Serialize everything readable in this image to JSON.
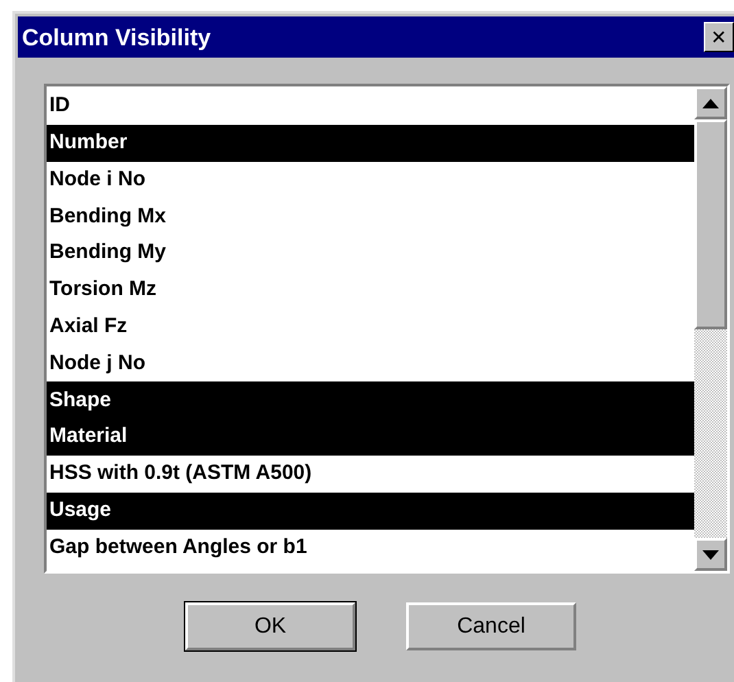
{
  "window": {
    "title": "Column Visibility",
    "close": "✕"
  },
  "columns": [
    {
      "label": "ID",
      "selected": false
    },
    {
      "label": "Number",
      "selected": true
    },
    {
      "label": "Node i No",
      "selected": false
    },
    {
      "label": "Bending Mx",
      "selected": false
    },
    {
      "label": "Bending My",
      "selected": false
    },
    {
      "label": "Torsion Mz",
      "selected": false
    },
    {
      "label": "Axial Fz",
      "selected": false
    },
    {
      "label": "Node j No",
      "selected": false
    },
    {
      "label": "Shape",
      "selected": true
    },
    {
      "label": "Material",
      "selected": true
    },
    {
      "label": "HSS with 0.9t (ASTM A500)",
      "selected": false
    },
    {
      "label": "Usage",
      "selected": true
    },
    {
      "label": "Gap between Angles or b1",
      "selected": false
    }
  ],
  "buttons": [
    {
      "label": "OK",
      "default": true
    },
    {
      "label": "Cancel",
      "default": false
    }
  ]
}
